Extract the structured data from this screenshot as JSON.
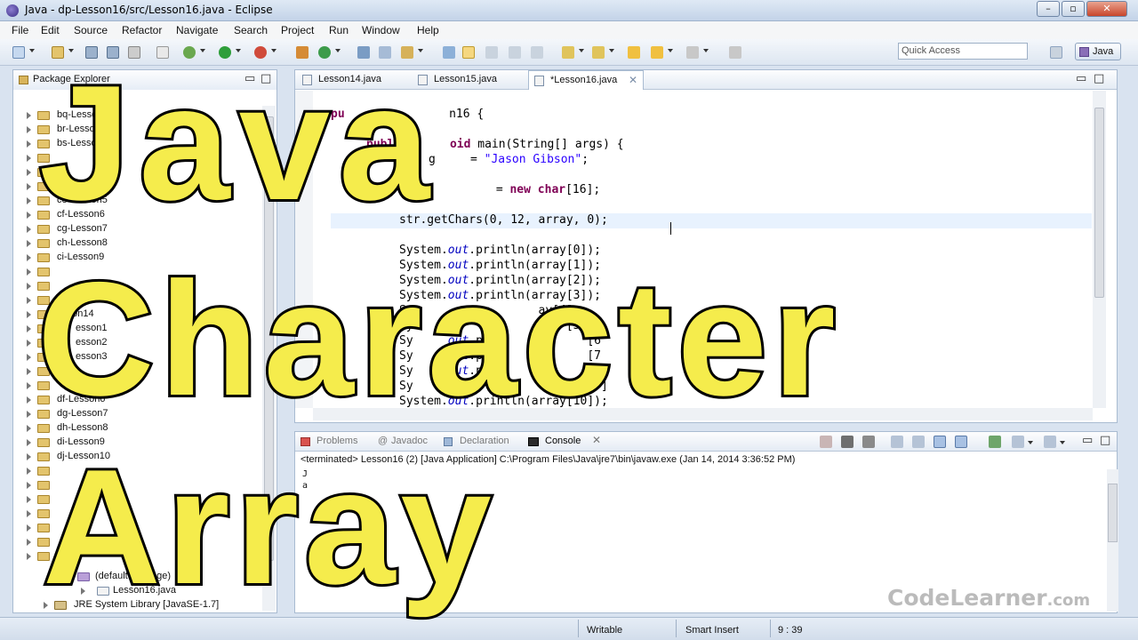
{
  "window": {
    "title": "Java - dp-Lesson16/src/Lesson16.java - Eclipse"
  },
  "menu": [
    "File",
    "Edit",
    "Source",
    "Refactor",
    "Navigate",
    "Search",
    "Project",
    "Run",
    "Window",
    "Help"
  ],
  "toolbar": {
    "quick_access_placeholder": "Quick Access",
    "perspective": "Java"
  },
  "package_explorer": {
    "title": "Package Explorer",
    "projects": [
      "bq-Lesson",
      "br-Lesson",
      "bs-Lesson",
      "ce-Lesson5",
      "cf-Lesson6",
      "cg-Lesson7",
      "ch-Lesson8",
      "ci-Lesson9",
      "esson14",
      "esson1",
      "esson2",
      "esson3",
      "df-Lesson6",
      "dg-Lesson7",
      "dh-Lesson8",
      "di-Lesson9",
      "dj-Lesson10"
    ],
    "sub_items": [
      "(default package)",
      "Lesson16.java"
    ],
    "jre": "JRE System Library [JavaSE-1.7]"
  },
  "editor": {
    "tabs": [
      "Lesson14.java",
      "Lesson15.java",
      "*Lesson16.java"
    ],
    "code": {
      "l1a": "pu",
      "l1b": "c",
      "l1c": "n16 {",
      "l2a": "publi",
      "l2b": "oid",
      "l2c": " main(String[] args) {",
      "l3a": "g",
      "l3b": " = ",
      "l3c": "\"Jason Gibson\"",
      "l3d": ";",
      "l4a": " = ",
      "l4b": "new",
      "l4c": " ",
      "l4d": "char",
      "l4e": "[16];",
      "l5": "str.getChars(0, 12, array, 0);",
      "sys": "System.",
      "out": "out",
      "p0": ".println(array[0]);",
      "p1": ".println(array[1]);",
      "p2": ".println(array[2]);",
      "p3": ".println(array[3]);",
      "p4": "pr",
      "p4b": "ay[4]",
      "p5": "[5",
      "p6a": "out",
      "p6b": ".prin",
      "p6c": "[6",
      "p7a": "out",
      "p7b": ".p",
      "p7c": "[7",
      "p8a": "out",
      "p8b": ".p",
      "p8c": "ln",
      "p8d": "[8",
      "p9a": "out",
      "p9b": ".p",
      "p9c": "[9]",
      "p10a": "System.",
      "p10b": "out",
      "p10c": ".println(array[10]);"
    }
  },
  "console": {
    "tabs": [
      "Problems",
      "Javadoc",
      "Declaration",
      "Console"
    ],
    "status": "<terminated> Lesson16 (2) [Java Application] C:\\Program Files\\Java\\jre7\\bin\\javaw.exe (Jan 14, 2014 3:36:52 PM)",
    "output": [
      "J",
      "a"
    ]
  },
  "status_bar": {
    "writable": "Writable",
    "insert": "Smart Insert",
    "position": "9 : 39"
  },
  "watermark": {
    "code": "CodeLearner",
    "com": ".com"
  },
  "overlay": {
    "line1": "Java",
    "line2": "Character",
    "line3": "Array"
  },
  "colors": {
    "overlay_fill": "#f5ec4c",
    "overlay_stroke": "#000000",
    "keyword": "#7f0055",
    "string": "#2a00ff",
    "field": "#0000c0"
  }
}
